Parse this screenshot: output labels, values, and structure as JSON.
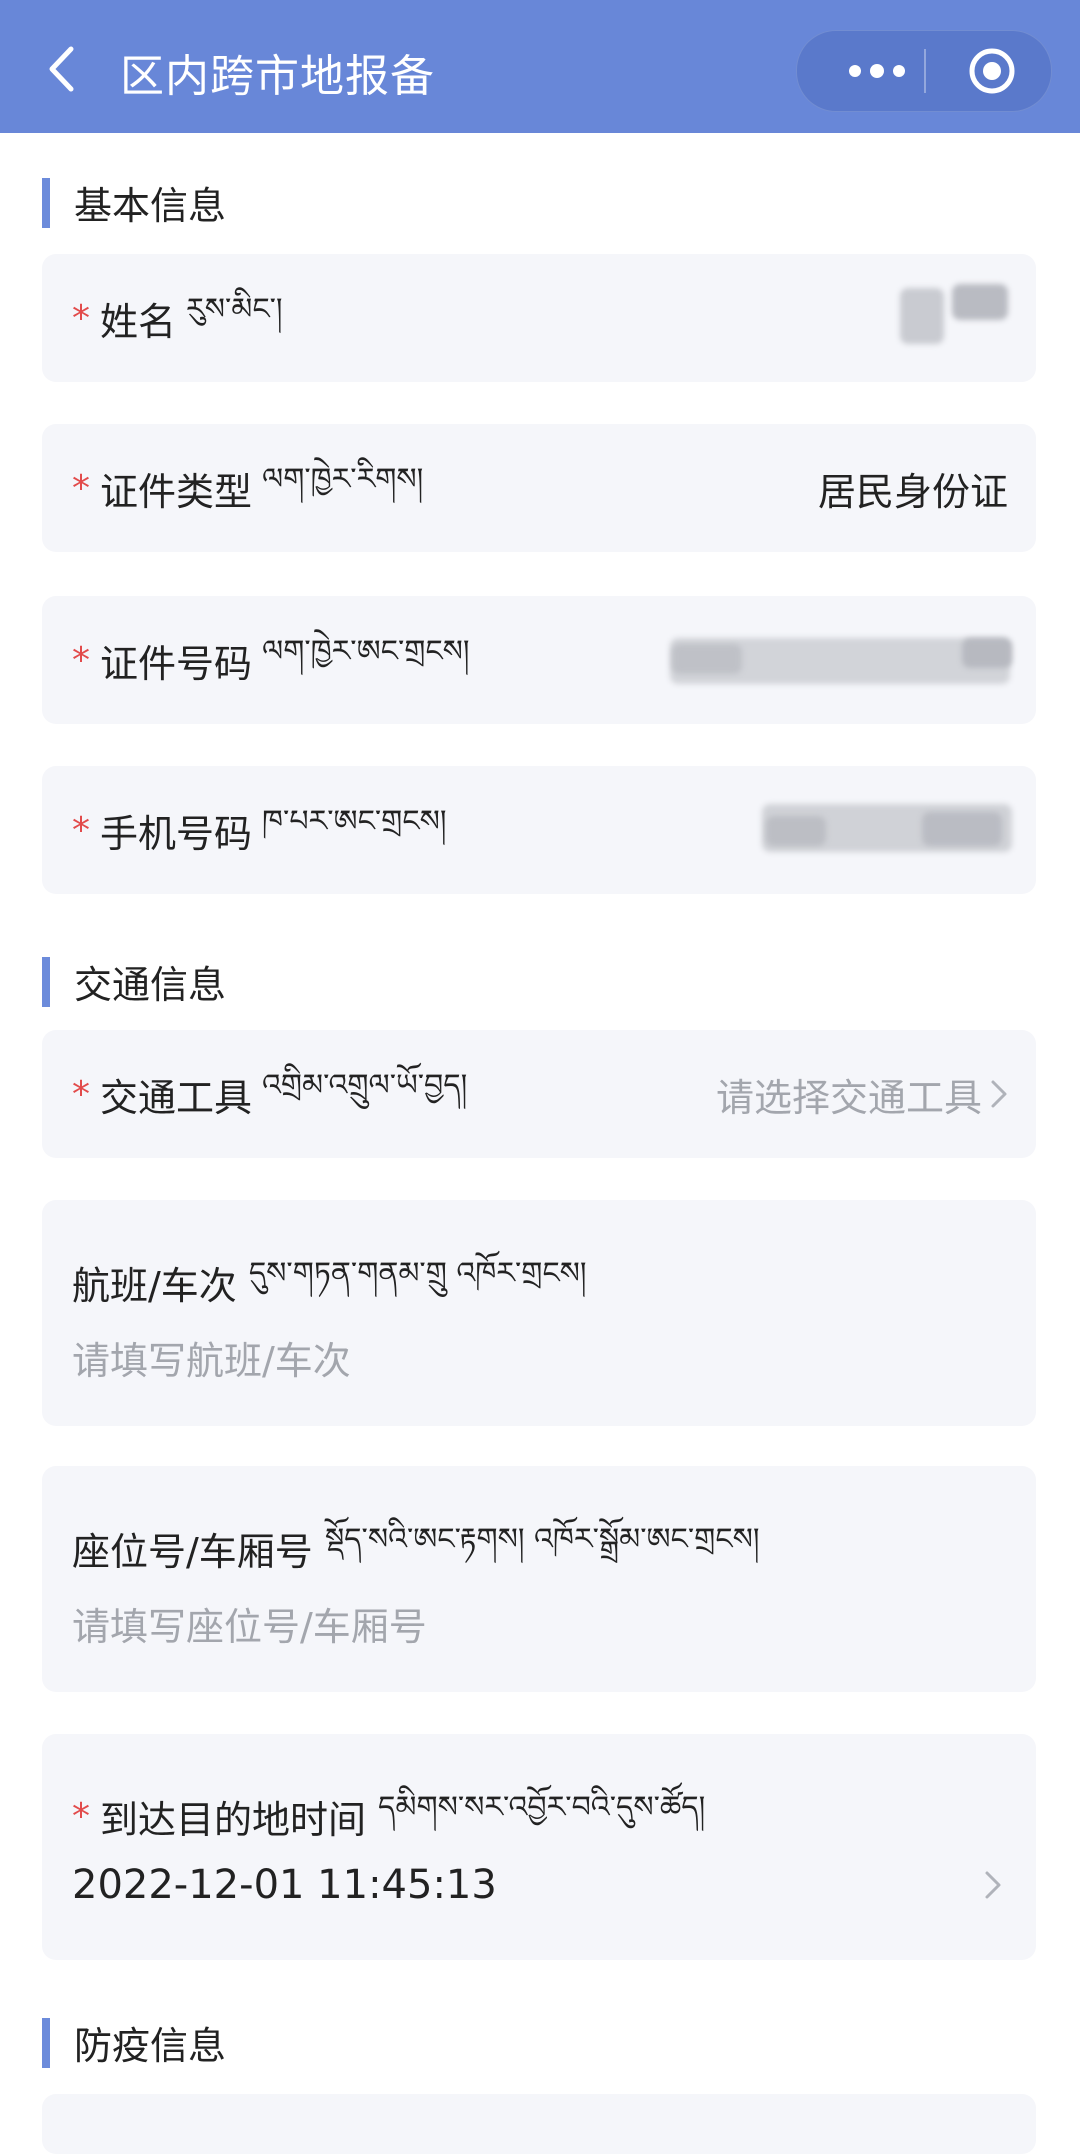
{
  "header": {
    "title": "区内跨市地报备",
    "back_icon": "chevron-left-icon",
    "more_icon": "more-dots-icon",
    "close_icon": "target-circle-icon"
  },
  "sections": {
    "basic": "基本信息",
    "transport": "交通信息",
    "epidemic": "防疫信息"
  },
  "basic_info": {
    "name": {
      "required": "*",
      "label": "姓名",
      "tibetan": "རུས་མིང་།",
      "value": ""
    },
    "id_type": {
      "required": "*",
      "label": "证件类型",
      "tibetan": "ལག་ཁྱེར་རིགས།",
      "value": "居民身份证"
    },
    "id_number": {
      "required": "*",
      "label": "证件号码",
      "tibetan": "ལག་ཁྱེར་ཨང་གྲངས།",
      "value": ""
    },
    "phone": {
      "required": "*",
      "label": "手机号码",
      "tibetan": "ཁ་པར་ཨང་གྲངས།",
      "value": ""
    }
  },
  "transport_info": {
    "vehicle": {
      "required": "*",
      "label": "交通工具",
      "tibetan": "འགྲིམ་འགྲུལ་ཡོ་བྱད།",
      "placeholder": "请选择交通工具"
    },
    "flight": {
      "label": "航班/车次",
      "tibetan": "དུས་གཏན་གནམ་གྲུ འཁོར་གྲངས།",
      "placeholder": "请填写航班/车次"
    },
    "seat": {
      "label": "座位号/车厢号",
      "tibetan": "སྡོད་སའི་ཨང་རྟགས། འཁོར་སྒྲོམ་ཨང་གྲངས།",
      "placeholder": "请填写座位号/车厢号"
    },
    "arrival": {
      "required": "*",
      "label": "到达目的地时间",
      "tibetan": "དམིགས་སར་འབྱོར་བའི་དུས་ཚོད།",
      "value": "2022-12-01 11:45:13"
    }
  },
  "colors": {
    "header": "#6887d8",
    "accent_bar": "#6c8bdb",
    "required": "#e24b4b",
    "placeholder": "#a3a6ad",
    "card_bg": "#f5f6fa"
  }
}
